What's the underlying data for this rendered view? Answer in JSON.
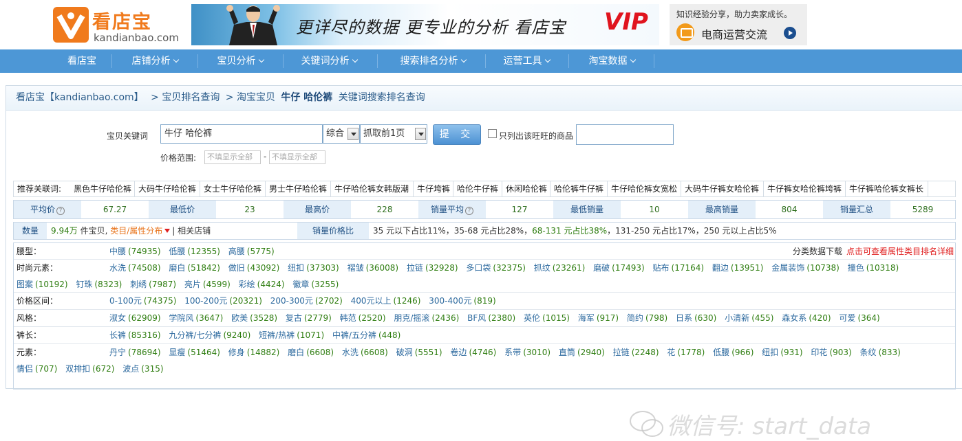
{
  "header": {
    "logo_cn": "看店宝",
    "logo_en": "kandianbao.com",
    "banner_text": "更详尽的数据 更专业的分析 看店宝",
    "banner_vip": "VIP",
    "promo_top": "知识经验分享，助力卖家成长。",
    "promo_main": "电商运营交流"
  },
  "nav": [
    {
      "label": "看店宝",
      "dropdown": false
    },
    {
      "label": "店铺分析",
      "dropdown": true
    },
    {
      "label": "宝贝分析",
      "dropdown": true
    },
    {
      "label": "关键词分析",
      "dropdown": true
    },
    {
      "label": "搜索排名分析",
      "dropdown": true
    },
    {
      "label": "运营工具",
      "dropdown": true
    },
    {
      "label": "淘宝数据",
      "dropdown": true
    }
  ],
  "breadcrumb": {
    "site": "看店宝【kandianbao.com】",
    "sep1": "> 宝贝排名查询",
    "sep2": "> 淘宝宝贝",
    "keyword": "牛仔 哈伦裤",
    "suffix": "关键词搜索排名查询"
  },
  "search": {
    "kw_label": "宝贝关键词",
    "kw_value": "牛仔 哈伦裤",
    "sort_value": "综合",
    "pages_value": "抓取前1页",
    "submit_label": "提 交",
    "only_ww_label": "只列出该旺旺的商品",
    "price_label": "价格范围:",
    "price_min_placeholder": "不填显示全部",
    "price_max_placeholder": "不填显示全部",
    "price_dash": "-"
  },
  "related": {
    "label": "推荐关联词:",
    "items": [
      "黑色牛仔哈伦裤",
      "大码牛仔哈伦裤",
      "女士牛仔哈伦裤",
      "男士牛仔哈伦裤",
      "牛仔哈伦裤女韩版潮",
      "牛仔垮裤",
      "哈伦牛仔裤",
      "休闲哈伦裤",
      "哈伦裤牛仔裤",
      "牛仔哈伦裤女宽松",
      "大码牛仔裤女哈伦裤",
      "牛仔裤女哈伦裤垮裤",
      "牛仔裤哈伦裤女裤长"
    ]
  },
  "stats": [
    {
      "label": "平均价",
      "help": true,
      "value": "67.27"
    },
    {
      "label": "最低价",
      "help": false,
      "value": "23"
    },
    {
      "label": "最高价",
      "help": false,
      "value": "228"
    },
    {
      "label": "销量平均",
      "help": true,
      "value": "127"
    },
    {
      "label": "最低销量",
      "help": false,
      "value": "10"
    },
    {
      "label": "最高销量",
      "help": false,
      "value": "804"
    },
    {
      "label": "销量汇总",
      "help": false,
      "value": "5289"
    }
  ],
  "count": {
    "label": "数量",
    "amount": "9.94万",
    "unit": "件宝贝,",
    "category_link": "类目/属性分布",
    "shops_link": "| 相关店铺",
    "ratio_label": "销量价格比",
    "ratio_a": "35 元以下占比11%，35-68 元占比28%，",
    "ratio_b": "68-131 元占比38%",
    "ratio_c": "，131-250 元占比17%，250 元以上占比5%"
  },
  "category_download": {
    "prefix": "分类数据下载",
    "link": "点击可查看属性类目排名详细"
  },
  "attributes": [
    {
      "name": "腰型：",
      "items": [
        [
          "中腰",
          "(74935)"
        ],
        [
          "低腰",
          "(12355)"
        ],
        [
          "高腰",
          "(5775)"
        ]
      ]
    },
    {
      "name": "时尚元素：",
      "wrap": true,
      "items": [
        [
          "水洗",
          "(74508)"
        ],
        [
          "磨白",
          "(51842)"
        ],
        [
          "做旧",
          "(43092)"
        ],
        [
          "纽扣",
          "(37303)"
        ],
        [
          "褶皱",
          "(36008)"
        ],
        [
          "拉链",
          "(32928)"
        ],
        [
          "多口袋",
          "(32375)"
        ],
        [
          "抓纹",
          "(23261)"
        ],
        [
          "磨破",
          "(17493)"
        ],
        [
          "贴布",
          "(17164)"
        ],
        [
          "翻边",
          "(13951)"
        ],
        [
          "金属装饰",
          "(10738)"
        ],
        [
          "撞色",
          "(10318)"
        ],
        [
          "图案",
          "(10192)"
        ],
        [
          "钉珠",
          "(8323)"
        ],
        [
          "刺绣",
          "(7987)"
        ],
        [
          "亮片",
          "(4599)"
        ],
        [
          "彩绘",
          "(4424)"
        ],
        [
          "徽章",
          "(3255)"
        ]
      ]
    },
    {
      "name": "价格区间：",
      "items": [
        [
          "0-100元",
          "(74375)"
        ],
        [
          "100-200元",
          "(20321)"
        ],
        [
          "200-300元",
          "(2702)"
        ],
        [
          "400元以上",
          "(1246)"
        ],
        [
          "300-400元",
          "(819)"
        ]
      ]
    },
    {
      "name": "风格：",
      "items": [
        [
          "淑女",
          "(62909)"
        ],
        [
          "学院风",
          "(3647)"
        ],
        [
          "欧美",
          "(3528)"
        ],
        [
          "复古",
          "(2779)"
        ],
        [
          "韩范",
          "(2520)"
        ],
        [
          "朋克/摇滚",
          "(2436)"
        ],
        [
          "BF风",
          "(2380)"
        ],
        [
          "英伦",
          "(1015)"
        ],
        [
          "海军",
          "(917)"
        ],
        [
          "简约",
          "(798)"
        ],
        [
          "日系",
          "(630)"
        ],
        [
          "小清新",
          "(455)"
        ],
        [
          "森女系",
          "(420)"
        ],
        [
          "可爱",
          "(364)"
        ]
      ]
    },
    {
      "name": "裤长：",
      "items": [
        [
          "长裤",
          "(85316)"
        ],
        [
          "九分裤/七分裤",
          "(9240)"
        ],
        [
          "短裤/热裤",
          "(1071)"
        ],
        [
          "中裤/五分裤",
          "(448)"
        ]
      ]
    },
    {
      "name": "元素：",
      "wrap": true,
      "items": [
        [
          "丹宁",
          "(78694)"
        ],
        [
          "显瘦",
          "(51464)"
        ],
        [
          "修身",
          "(14882)"
        ],
        [
          "磨白",
          "(6608)"
        ],
        [
          "水洗",
          "(6608)"
        ],
        [
          "破洞",
          "(5551)"
        ],
        [
          "卷边",
          "(4746)"
        ],
        [
          "系带",
          "(3010)"
        ],
        [
          "直筒",
          "(2940)"
        ],
        [
          "拉链",
          "(2248)"
        ],
        [
          "花",
          "(1778)"
        ],
        [
          "低腰",
          "(966)"
        ],
        [
          "纽扣",
          "(931)"
        ],
        [
          "印花",
          "(903)"
        ],
        [
          "条纹",
          "(833)"
        ],
        [
          "情侣",
          "(707)"
        ],
        [
          "双排扣",
          "(672)"
        ],
        [
          "波点",
          "(315)"
        ]
      ]
    }
  ],
  "watermark": "微信号: start_data",
  "colors": {
    "nav_bg": "#4d97d6",
    "brand_orange": "#f07a1c",
    "link_blue": "#2d6a9f",
    "count_green": "#2e7d10"
  }
}
